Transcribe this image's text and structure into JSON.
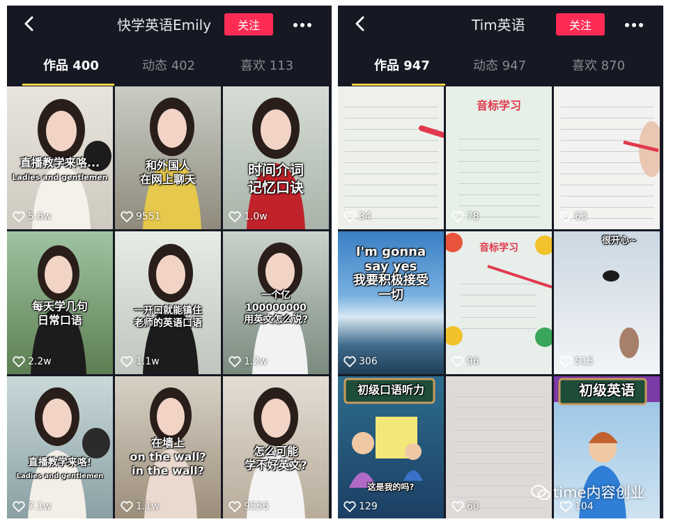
{
  "left": {
    "title": "快学英语Emily",
    "follow_label": "关注",
    "tabs": [
      "作品 400",
      "动态 402",
      "喜欢 113"
    ],
    "videos": [
      {
        "caption": "直播教学来咯...",
        "sub": "Ladies and gentlemen",
        "likes": "5.6w"
      },
      {
        "caption": "和外国人\n在网上聊天",
        "likes": "9551"
      },
      {
        "caption": "时间介词\n记忆口诀",
        "likes": "1.0w"
      },
      {
        "caption": "每天学几句\n日常口语",
        "likes": "2.2w"
      },
      {
        "caption": "一开口就能镇住\n老师的英语口语",
        "likes": "1.1w"
      },
      {
        "caption": "一个亿\n100000000\n用英文怎么说?",
        "likes": "1.2w"
      },
      {
        "caption": "直播教学来咯!",
        "sub": "Ladies and gentlemen",
        "likes": "7.1w"
      },
      {
        "caption": "在墙上\non the wall?\nin the wall?",
        "likes": "1.1w"
      },
      {
        "caption": "怎么可能\n学不好英文?",
        "likes": "9556"
      }
    ]
  },
  "right": {
    "title": "Tim英语",
    "follow_label": "关注",
    "tabs": [
      "作品 947",
      "动态 947",
      "喜欢 870"
    ],
    "videos": [
      {
        "caption": "",
        "likes": "34"
      },
      {
        "caption": "音标学习",
        "likes": "78"
      },
      {
        "caption": "",
        "likes": "63"
      },
      {
        "caption": "I'm gonna\nsay yes\n我要积极接受\n一切",
        "likes": "306"
      },
      {
        "caption": "音标学习",
        "likes": "96"
      },
      {
        "caption": "很开心~",
        "likes": "515"
      },
      {
        "caption": "初级口语听力",
        "sub": "这是我的吗?",
        "likes": "129"
      },
      {
        "caption": "",
        "likes": "60"
      },
      {
        "caption": "初级英语",
        "likes": "104"
      }
    ]
  },
  "watermark": "time内容创业",
  "colors": {
    "bg": "#161823",
    "accent": "#fe2c55",
    "tab_indicator": "#f8d54a"
  },
  "icons": [
    "back-arrow-icon",
    "more-dots-icon",
    "heart-icon",
    "wechat-icon"
  ]
}
